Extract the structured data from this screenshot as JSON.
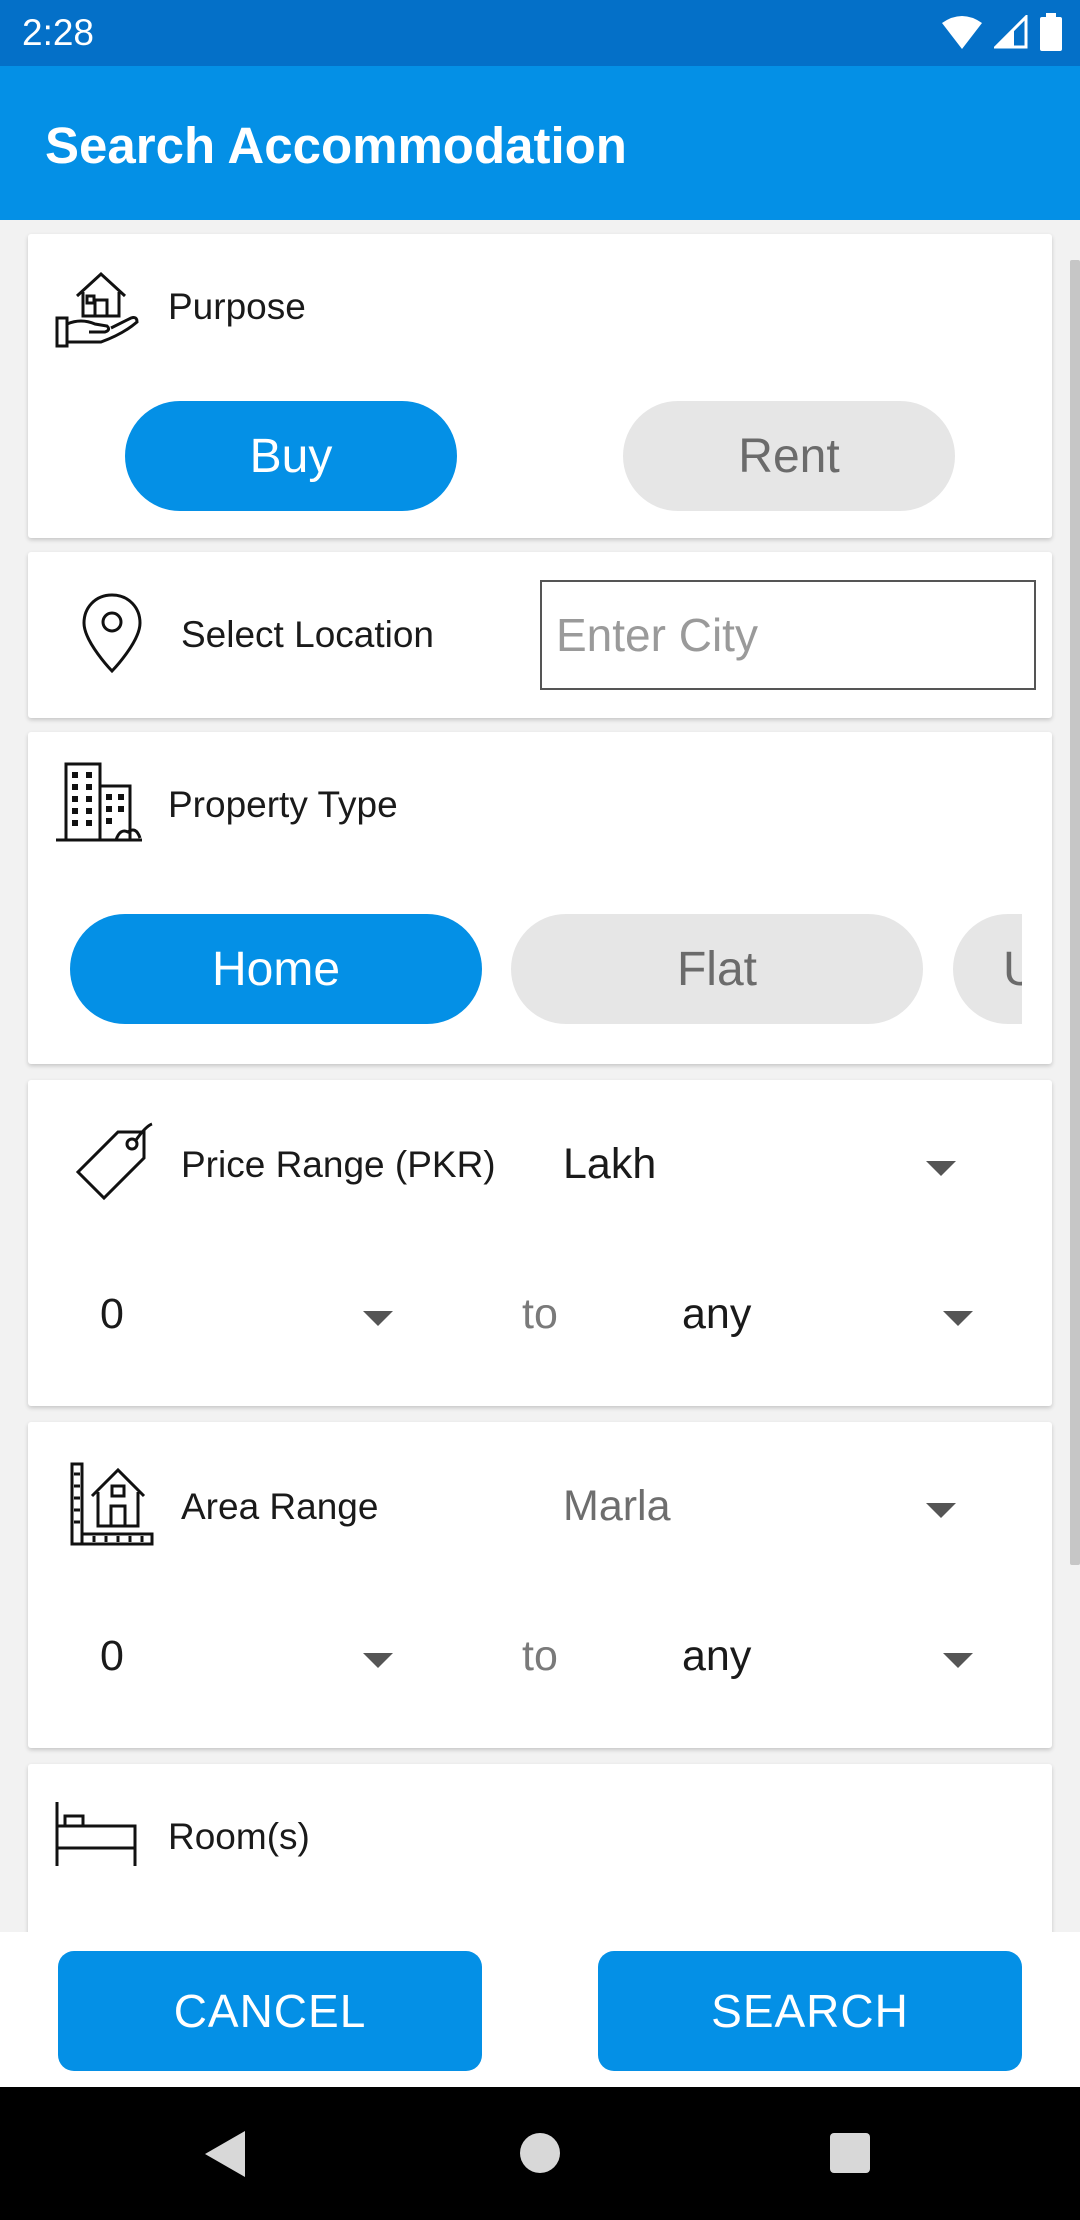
{
  "status_bar": {
    "time": "2:28"
  },
  "app_bar": {
    "title": "Search Accommodation"
  },
  "purpose": {
    "label": "Purpose",
    "options": [
      "Buy",
      "Rent"
    ],
    "selected": "Buy"
  },
  "location": {
    "label": "Select Location",
    "city_placeholder": "Enter City",
    "city_value": ""
  },
  "property_type": {
    "label": "Property Type",
    "options": [
      "Home",
      "Flat",
      "U"
    ],
    "selected": "Home"
  },
  "price_range": {
    "label": "Price Range (PKR)",
    "unit": "Lakh",
    "min": "0",
    "to_label": "to",
    "max": "any"
  },
  "area_range": {
    "label": "Area Range",
    "unit": "Marla",
    "min": "0",
    "to_label": "to",
    "max": "any"
  },
  "rooms": {
    "label": "Room(s)"
  },
  "actions": {
    "cancel": "CANCEL",
    "search": "SEARCH"
  },
  "colors": {
    "primary": "#0490e6",
    "status_bar": "#0470c8",
    "inactive_pill": "#e6e6e6"
  }
}
